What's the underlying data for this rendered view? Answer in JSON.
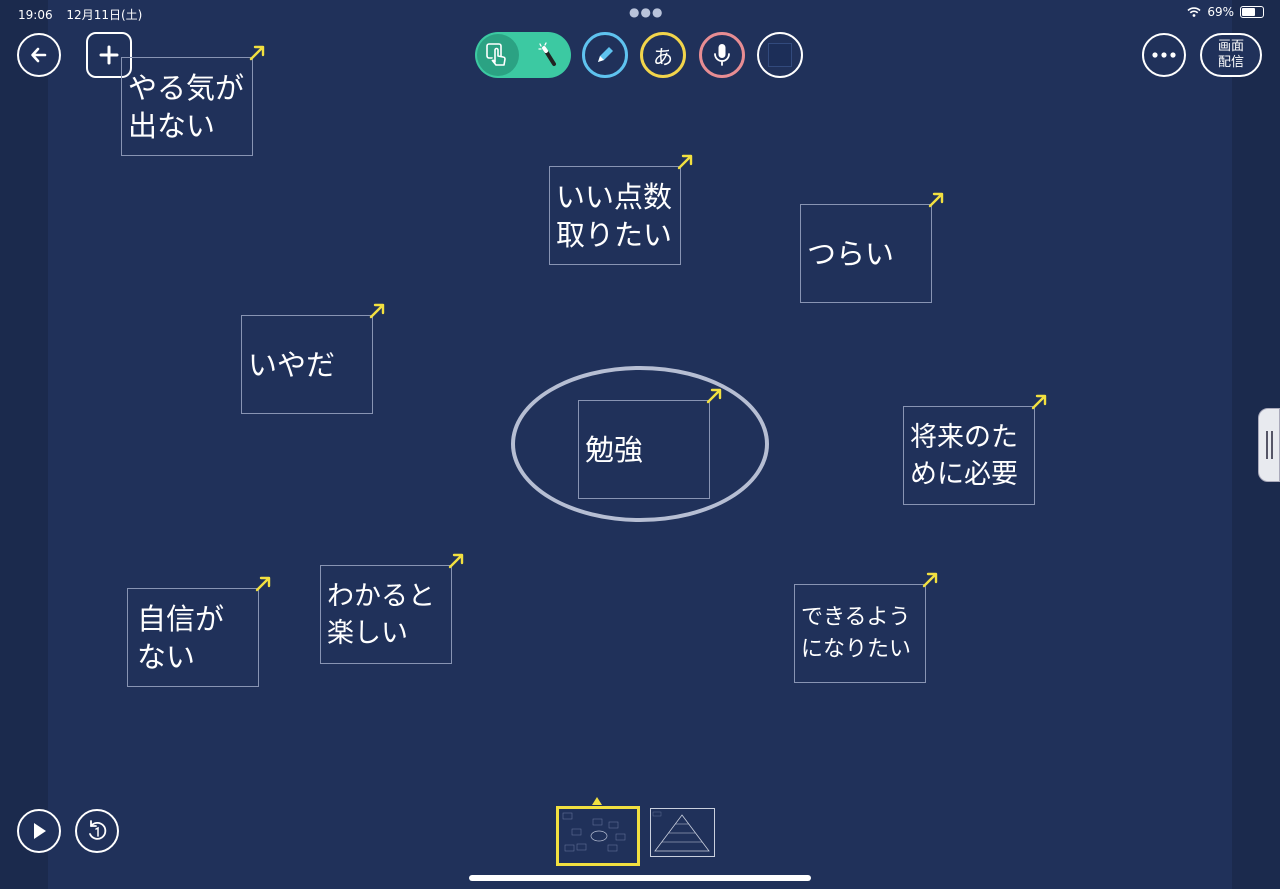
{
  "status_bar": {
    "time": "19:06",
    "date": "12月11日(土)",
    "battery": "69%"
  },
  "header": {
    "broadcast_label": "画面\n配信"
  },
  "toolbar": {
    "text_tool_glyph": "あ",
    "accent_color": "#3cc9a2",
    "highlight_color": "#f2e040"
  },
  "cards": [
    {
      "text": "やる気が\n出ない"
    },
    {
      "text": "いい点数\n取りたい"
    },
    {
      "text": "つらい"
    },
    {
      "text": "いやだ"
    },
    {
      "text": "勉強"
    },
    {
      "text": "将来のた\nめに必要"
    },
    {
      "text": "自信が\nない"
    },
    {
      "text": "わかると\n楽しい"
    },
    {
      "text": "できるよう\nになりたい"
    }
  ],
  "thumbnails": {
    "count": 2,
    "selected_index": 0
  }
}
